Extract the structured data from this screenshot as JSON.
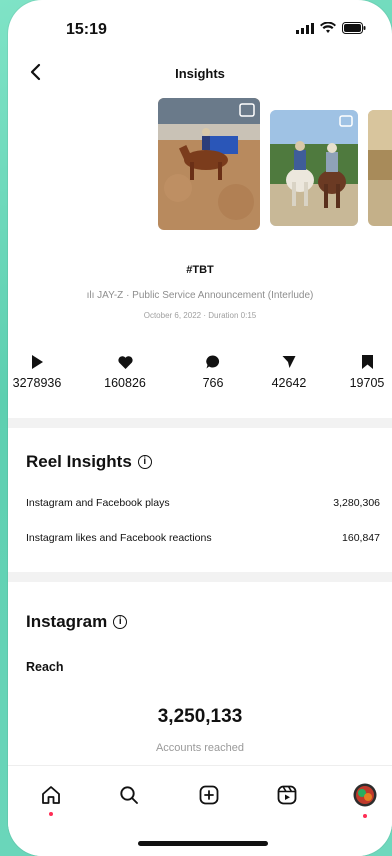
{
  "status_bar": {
    "time": "15:19"
  },
  "header": {
    "title": "Insights"
  },
  "reel": {
    "hashtag": "#TBT",
    "audio": "JAY-Z · Public Service Announcement (Interlude)",
    "date_duration": "October 6, 2022 · Duration 0:15"
  },
  "stats": [
    {
      "icon": "play-icon",
      "value": "3278936"
    },
    {
      "icon": "heart-icon",
      "value": "160826"
    },
    {
      "icon": "comment-icon",
      "value": "766"
    },
    {
      "icon": "share-icon",
      "value": "42642"
    },
    {
      "icon": "save-icon",
      "value": "19705"
    }
  ],
  "reel_insights": {
    "title": "Reel Insights",
    "rows": [
      {
        "label": "Instagram and Facebook plays",
        "value": "3,280,306"
      },
      {
        "label": "Instagram likes and Facebook reactions",
        "value": "160,847"
      }
    ]
  },
  "instagram": {
    "title": "Instagram",
    "reach_label": "Reach",
    "reach_value": "3,250,133",
    "reach_caption": "Accounts reached"
  },
  "tabbar": [
    "home-icon",
    "search-icon",
    "create-icon",
    "reels-icon",
    "profile-avatar"
  ],
  "colors": {
    "accent_dot": "#ff2d55",
    "background": "#6fd8bd"
  }
}
